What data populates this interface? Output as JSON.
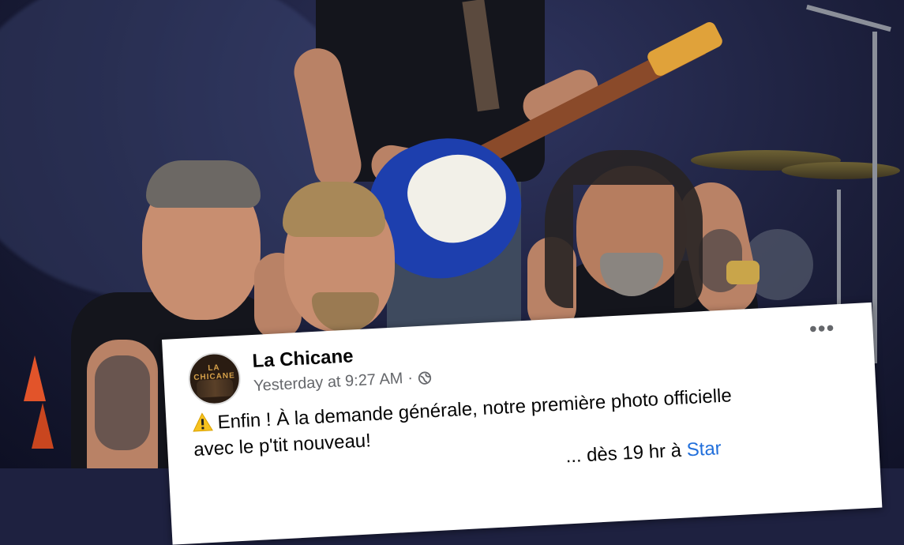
{
  "post": {
    "page_name": "La Chicane",
    "timestamp": "Yesterday at 9:27 AM",
    "separator": "·",
    "privacy_icon": "globe-icon",
    "more_icon": "more-options-icon",
    "more_glyph": "•••",
    "warning_emoji": "⚠️",
    "text_line1": "Enfin ! À la demande générale, notre première photo officielle",
    "text_line2": "avec le p'tit nouveau!",
    "text_line3_partial": "... dès 19 hr à",
    "text_line3_link": "Star"
  },
  "avatar": {
    "label": "LA CHICANE"
  },
  "colors": {
    "link": "#216fdb",
    "meta": "#65676b",
    "guitar_body": "#1d3fae",
    "background": "#1e2140"
  }
}
